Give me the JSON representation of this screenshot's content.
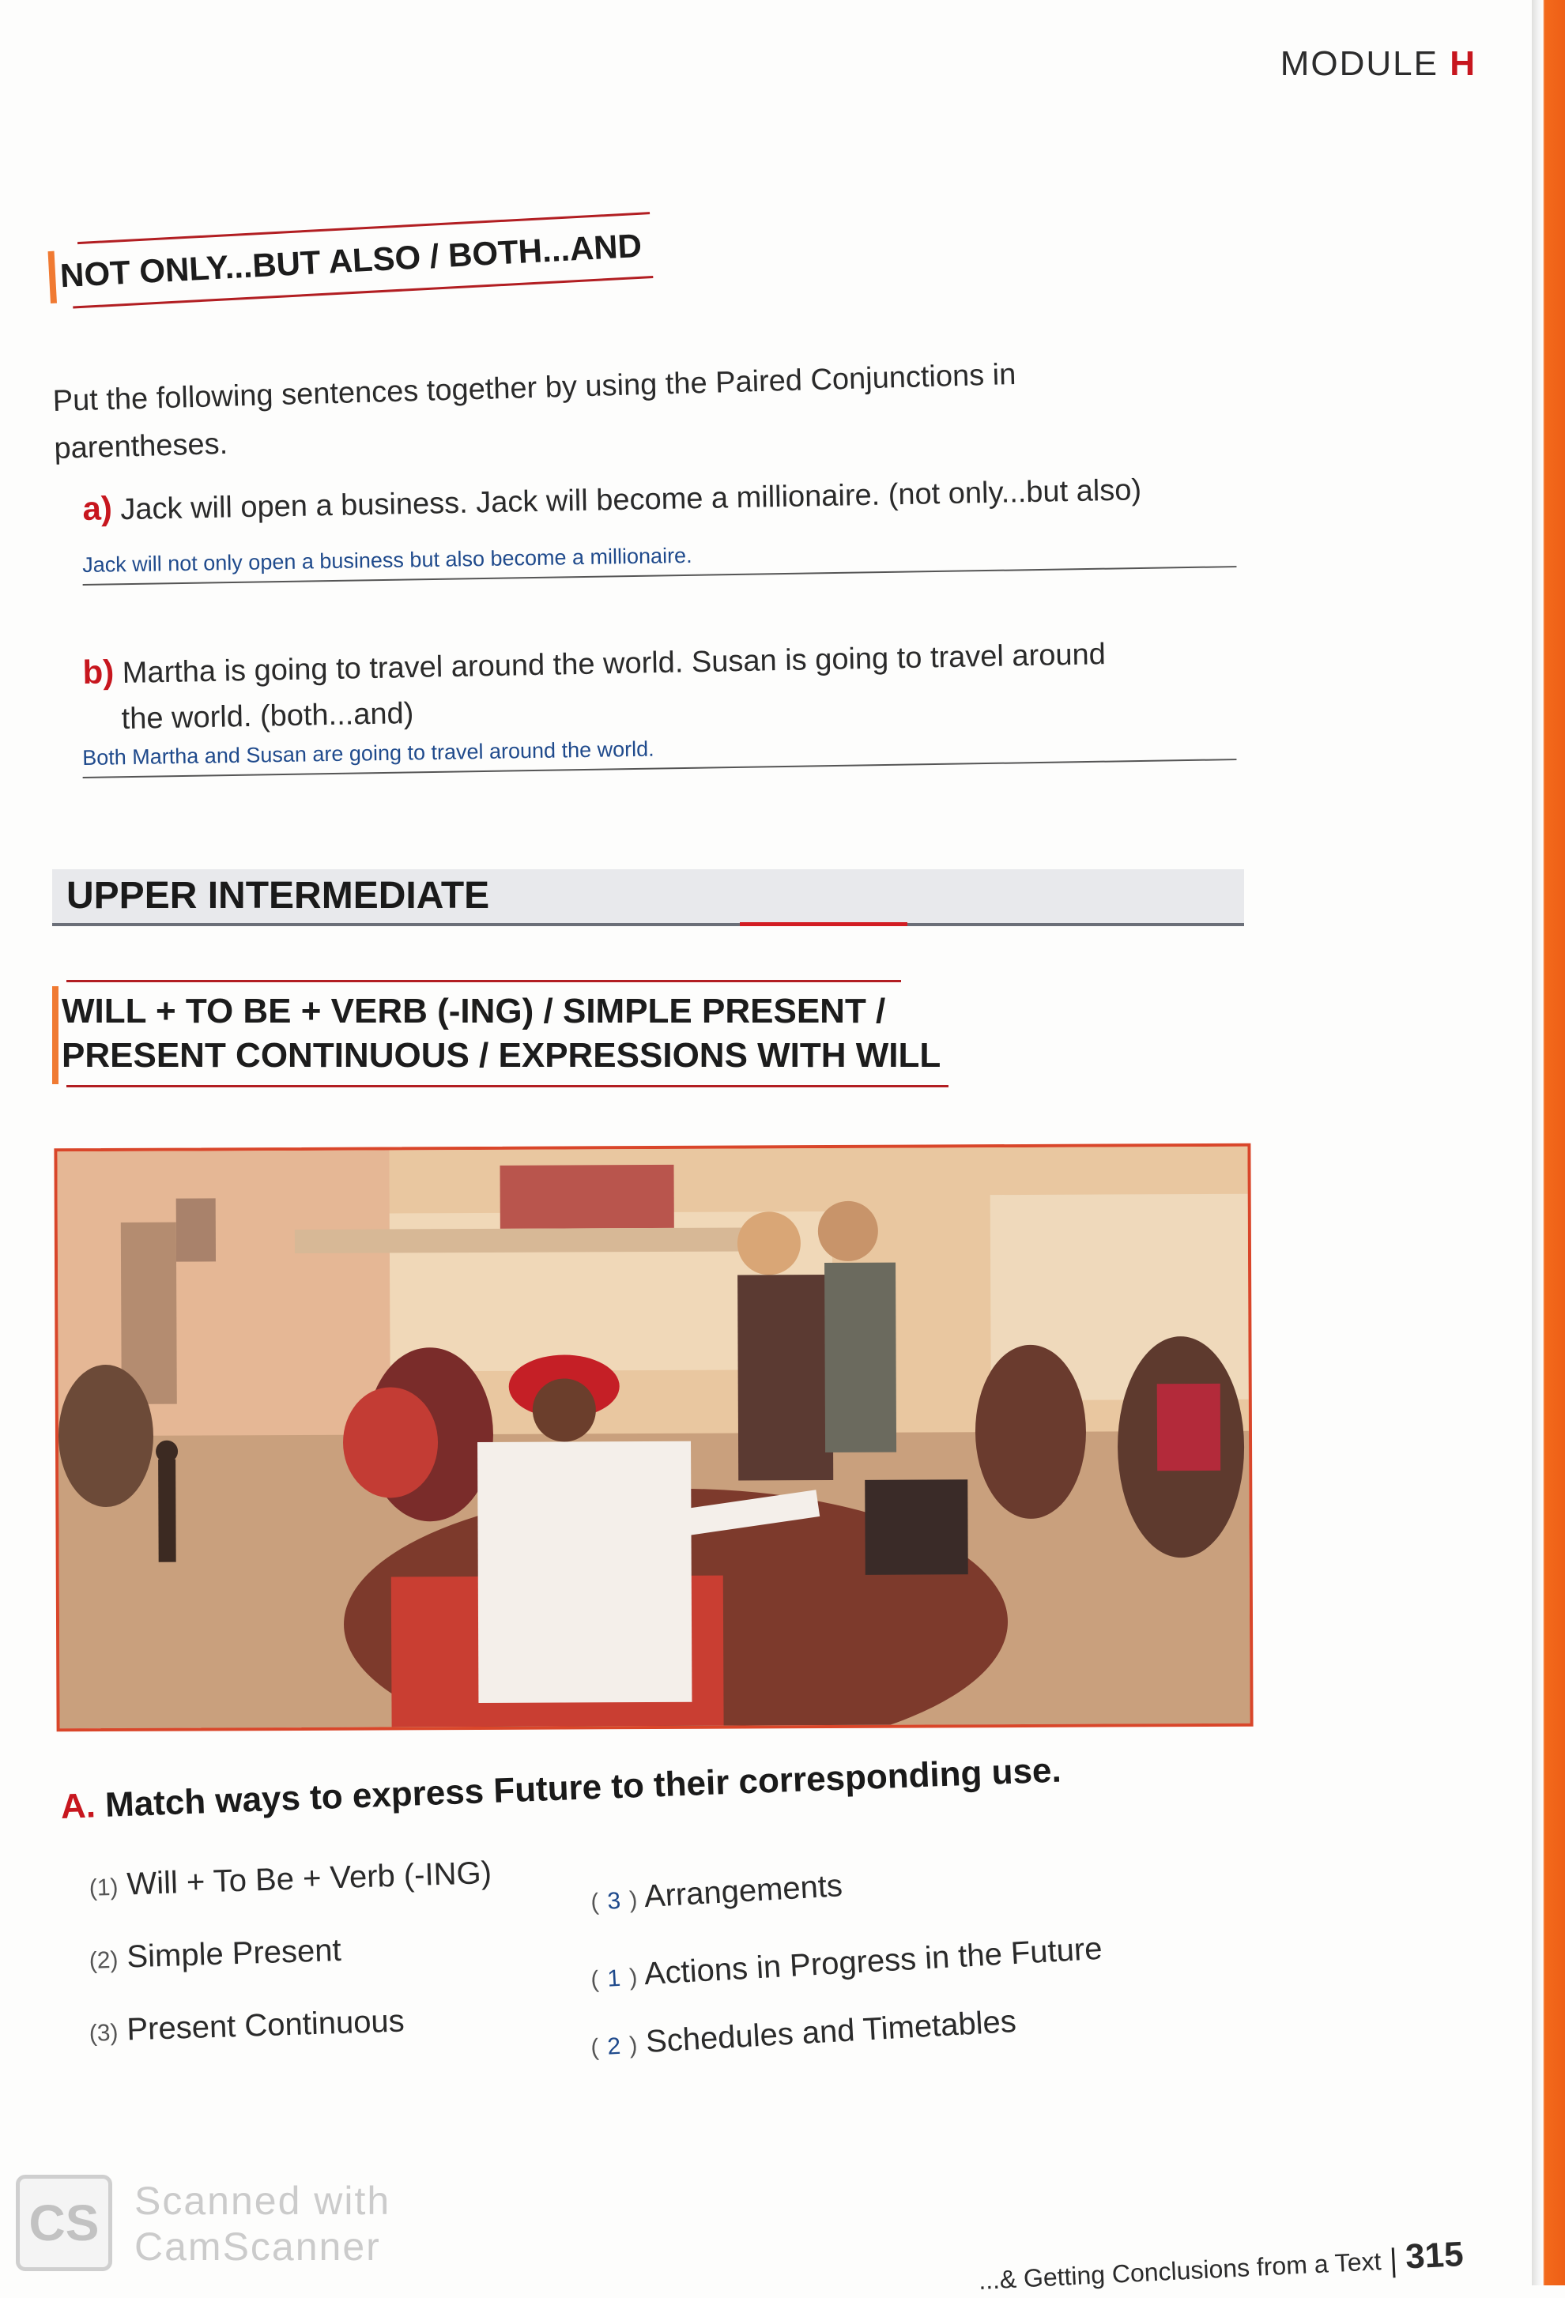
{
  "header": {
    "module_word": "MODULE",
    "module_letter": "H"
  },
  "section1": {
    "title": "NOT ONLY...BUT ALSO / BOTH...AND",
    "instruction": "Put the following sentences together by using the Paired Conjunctions in parentheses.",
    "items": [
      {
        "letter": "a)",
        "text": "Jack will open a business. Jack will become a millionaire. (not only...but also)",
        "answer": "Jack will not only open a business but also become a millionaire."
      },
      {
        "letter": "b)",
        "text": "Martha is going to travel around the world. Susan is going to travel around",
        "text_cont": "the world. (both...and)",
        "answer": "Both Martha and Susan are going to travel around the world."
      }
    ]
  },
  "level_bar": {
    "label": "UPPER INTERMEDIATE"
  },
  "section2": {
    "title_line1": "WILL + TO BE + VERB (-ING) / SIMPLE PRESENT /",
    "title_line2": "PRESENT CONTINUOUS / EXPRESSIONS WITH WILL"
  },
  "exercise_a": {
    "letter": "A.",
    "prompt": "Match ways to express Future to their corresponding use.",
    "left": [
      {
        "num": "(1)",
        "label": "Will + To Be + Verb (-ING)"
      },
      {
        "num": "(2)",
        "label": "Simple Present"
      },
      {
        "num": "(3)",
        "label": "Present Continuous"
      }
    ],
    "right": [
      {
        "open": "(",
        "answer": "3",
        "close": ")",
        "label": "Arrangements"
      },
      {
        "open": "(",
        "answer": "1",
        "close": ")",
        "label": "Actions in Progress in the Future"
      },
      {
        "open": "(",
        "answer": "2",
        "close": ")",
        "label": "Schedules and Timetables"
      }
    ]
  },
  "watermark": {
    "logo": "CS",
    "line1": "Scanned with",
    "line2": "CamScanner"
  },
  "footer": {
    "text": "...& Getting Conclusions from a Text",
    "page": "315"
  },
  "colors": {
    "accent_red": "#c7161e",
    "orange_edge": "#ee5f16",
    "answer_blue": "#1f4a8c"
  }
}
